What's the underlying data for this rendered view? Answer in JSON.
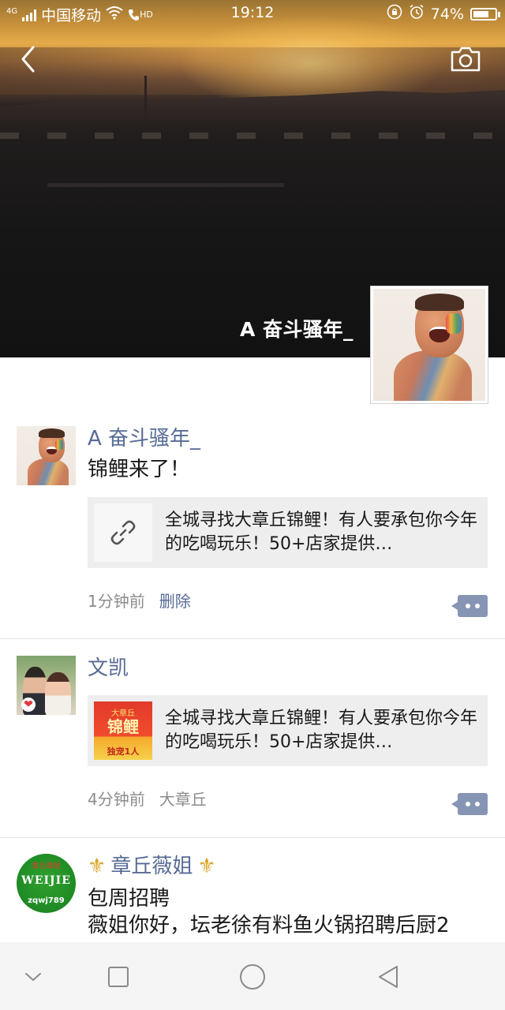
{
  "status_bar": {
    "network_type": "4G",
    "carrier": "中国移动",
    "hd_label": "HD",
    "time": "19:12",
    "battery_percent": "74%",
    "battery_level": 0.74
  },
  "profile": {
    "name": "A   奋斗骚年_"
  },
  "posts": [
    {
      "author": "A   奋斗骚年_",
      "text": "锦鲤来了！",
      "link_title": "全城寻找大章丘锦鲤！有人要承包你今年的吃喝玩乐！50+店家提供…",
      "time_ago": "1分钟前",
      "action": "删除"
    },
    {
      "author": "文凯",
      "link_title": "全城寻找大章丘锦鲤！有人要承包你今年的吃喝玩乐！50+店家提供…",
      "thumb_top": "大章丘",
      "thumb_mid": "锦鲤",
      "thumb_bottom": "独宠1人",
      "time_ago": "4分钟前",
      "location": "大章丘"
    },
    {
      "author": "章丘薇姐",
      "avatar_top": "章丘薇姐",
      "avatar_mid": "WEIJIE",
      "avatar_bottom": "zqwj789",
      "text_line1": "包周招聘",
      "text_line2": "薇姐你好，坛老徐有料鱼火锅招聘后厨2"
    }
  ],
  "colors": {
    "link_name": "#576b95",
    "comment_button": "#8795b5",
    "card_bg": "#eeeeee",
    "nav_bg": "#f5f5f5"
  },
  "icons": {
    "back": "chevron-left-icon",
    "camera": "camera-icon",
    "link": "link-icon",
    "comment": "comment-dots-icon",
    "crown": "crown-icon",
    "nav_down": "chevron-down-icon",
    "nav_recents": "square-icon",
    "nav_home": "circle-icon",
    "nav_back": "triangle-back-icon"
  }
}
